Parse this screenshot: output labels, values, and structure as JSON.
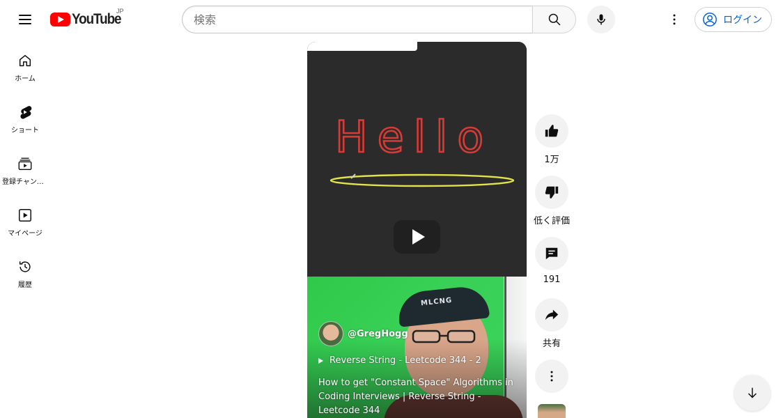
{
  "header": {
    "logo_text": "YouTube",
    "region": "JP",
    "search_placeholder": "検索",
    "login_label": "ログイン"
  },
  "sidebar": {
    "items": [
      {
        "label": "ホーム",
        "icon": "home-icon"
      },
      {
        "label": "ショート",
        "icon": "shorts-icon"
      },
      {
        "label": "登録チャンネル",
        "icon": "subscriptions-icon"
      },
      {
        "label": "マイページ",
        "icon": "library-icon"
      },
      {
        "label": "履歴",
        "icon": "history-icon"
      }
    ]
  },
  "video": {
    "channel": "@GregHogg",
    "playlist": "Reverse String - Leetcode 344 - 2",
    "title": "How to get \"Constant Space\" Algorithms in Coding Interviews | Reverse String - Leetcode 344",
    "overlay_text": "Hello",
    "cap_text": "MLCNG"
  },
  "actions": {
    "like_count": "1万",
    "dislike_label": "低く評価",
    "comment_count": "191",
    "share_label": "共有"
  },
  "colors": {
    "brand_red": "#ff0000",
    "link_blue": "#065fd4",
    "video_bg": "#2b2b2b",
    "green_screen": "#38d056"
  }
}
